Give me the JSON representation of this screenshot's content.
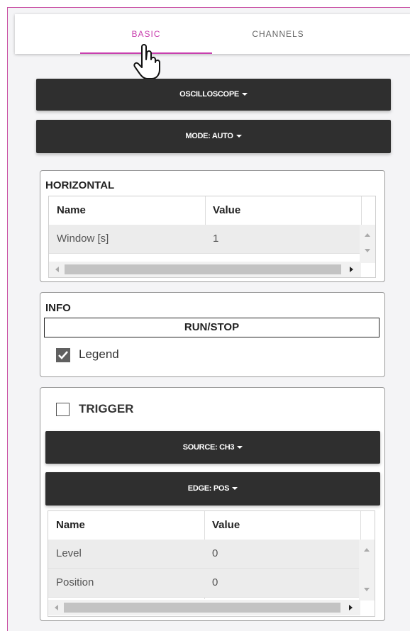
{
  "tabs": {
    "basic": "BASIC",
    "channels": "CHANNELS"
  },
  "buttons": {
    "oscilloscope": "OSCILLOSCOPE",
    "mode": "MODE: AUTO"
  },
  "horizontal": {
    "title": "HORIZONTAL",
    "headers": {
      "name": "Name",
      "value": "Value"
    },
    "rows": [
      {
        "name": "Window [s]",
        "value": "1"
      }
    ]
  },
  "info": {
    "title": "INFO",
    "run_stop": "RUN/STOP",
    "legend_label": "Legend",
    "legend_checked": true
  },
  "trigger": {
    "label": "TRIGGER",
    "checked": false,
    "source_button": "SOURCE: CH3",
    "edge_button": "EDGE: POS",
    "headers": {
      "name": "Name",
      "value": "Value"
    },
    "rows": [
      {
        "name": "Level",
        "value": "0"
      },
      {
        "name": "Position",
        "value": "0"
      }
    ]
  },
  "colors": {
    "accent": "#c83fae",
    "dark_button": "#2f2f2f",
    "frame_border": "#c94fa3"
  }
}
